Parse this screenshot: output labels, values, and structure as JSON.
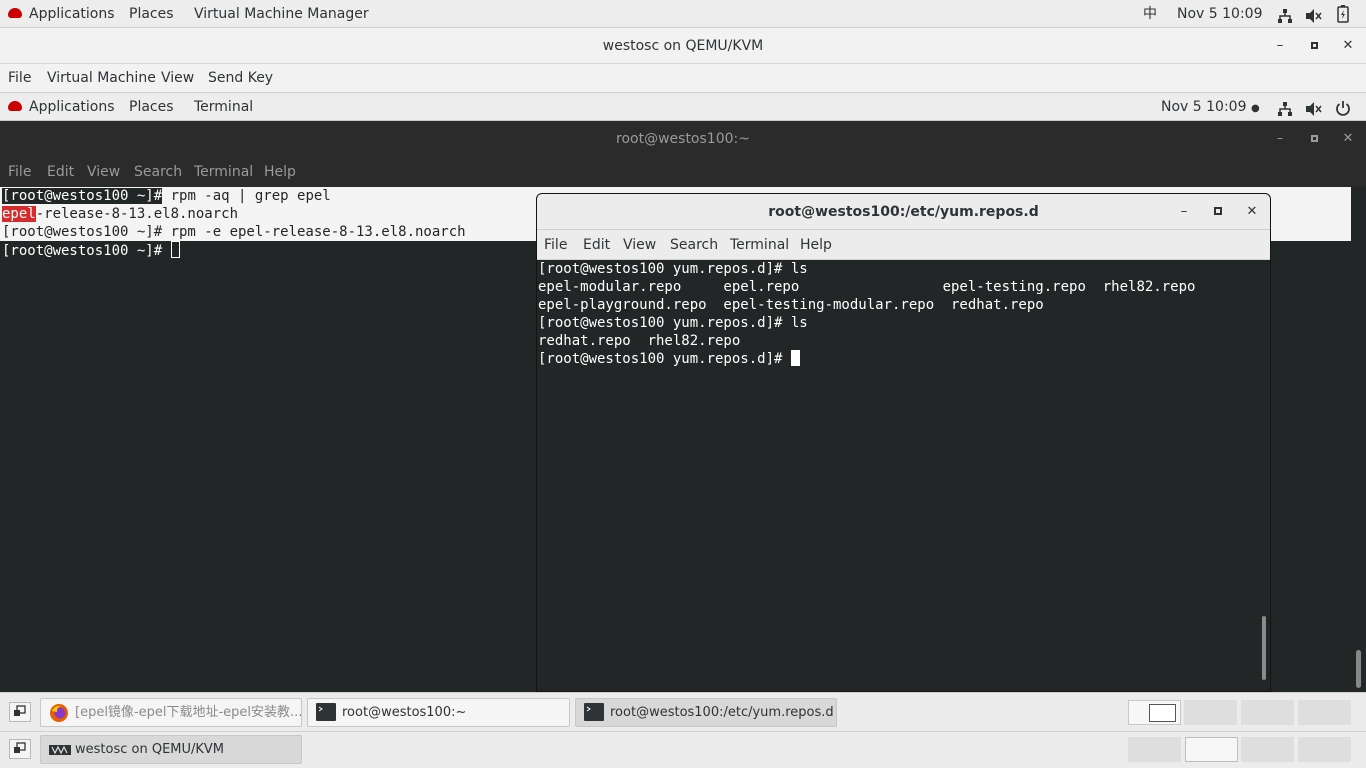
{
  "host_topbar": {
    "applications": "Applications",
    "places": "Places",
    "vmm": "Virtual Machine Manager",
    "input_method": "中",
    "clock": "Nov 5  10:09"
  },
  "vm_window": {
    "title": "westosc on QEMU/KVM",
    "menu": [
      "File",
      "Virtual Machine",
      "View",
      "Send Key"
    ]
  },
  "guest_topbar": {
    "applications": "Applications",
    "places": "Places",
    "terminal": "Terminal",
    "clock": "Nov 5  10:09"
  },
  "terminal1": {
    "title": "root@westos100:~",
    "menu": [
      "File",
      "Edit",
      "View",
      "Search",
      "Terminal",
      "Help"
    ],
    "lines": {
      "l1_prompt": "[root@westos100 ~]#",
      "l1_cmd": " rpm -aq | grep epel",
      "l2_hl": "epel",
      "l2_rest": "-release-8-13.el8.noarch",
      "l3": "[root@westos100 ~]# rpm -e epel-release-8-13.el8.noarch",
      "l4": "[root@westos100 ~]# "
    }
  },
  "terminal2": {
    "title": "root@westos100:/etc/yum.repos.d",
    "menu": [
      "File",
      "Edit",
      "View",
      "Search",
      "Terminal",
      "Help"
    ],
    "lines": [
      "[root@westos100 yum.repos.d]# ls",
      "epel-modular.repo     epel.repo                 epel-testing.repo  rhel82.repo",
      "epel-playground.repo  epel-testing-modular.repo  redhat.repo",
      "[root@westos100 yum.repos.d]# ls",
      "redhat.repo  rhel82.repo",
      "[root@westos100 yum.repos.d]# "
    ]
  },
  "guest_taskbar": {
    "tasks": [
      "[epel镜像-epel下载地址-epel安装教...",
      "root@westos100:~",
      "root@westos100:/etc/yum.repos.d"
    ]
  },
  "host_taskbar": {
    "tasks": [
      "westosc on QEMU/KVM"
    ]
  },
  "colors": {
    "terminal_bg": "#232627",
    "highlight_red": "#d52b2b",
    "redhat_logo": "#cc0000"
  }
}
